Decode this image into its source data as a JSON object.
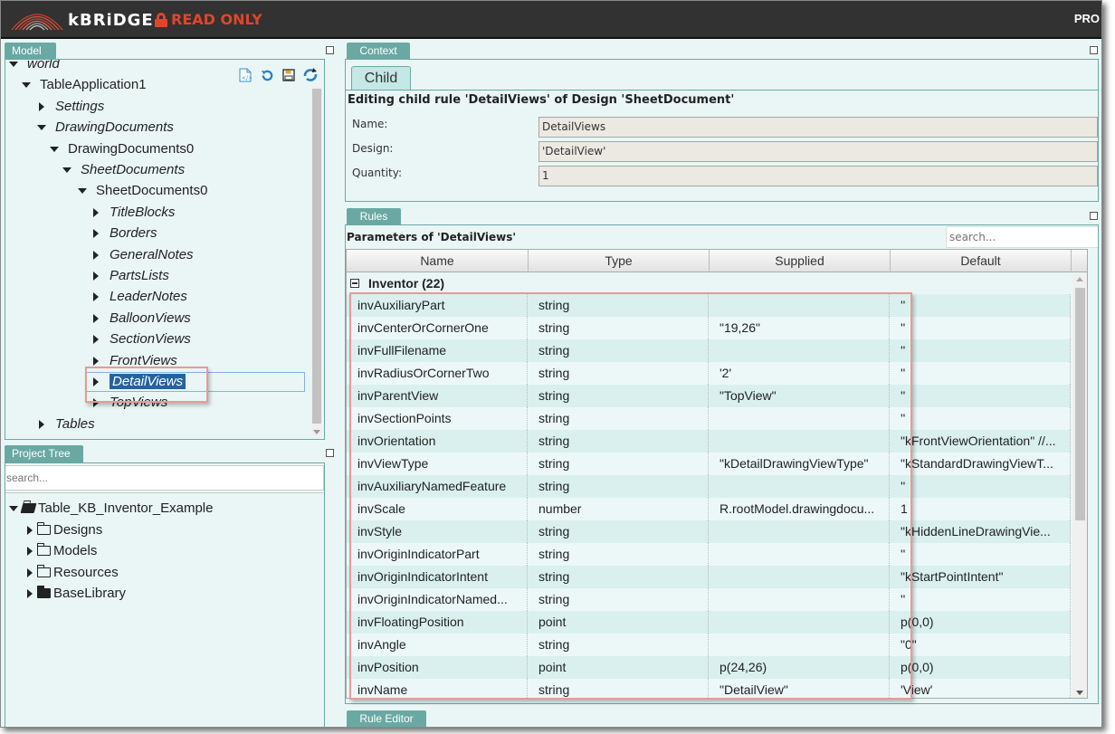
{
  "header": {
    "brand": "kBRiDGE",
    "mode": "READ ONLY",
    "right_label": "PRO"
  },
  "model_panel": {
    "tab": "Model",
    "tree": [
      {
        "label": "world",
        "depth": 0,
        "expanded": true,
        "italic": true
      },
      {
        "label": "TableApplication1",
        "depth": 1,
        "expanded": true,
        "italic": false
      },
      {
        "label": "Settings",
        "depth": 2,
        "expanded": false,
        "italic": true
      },
      {
        "label": "DrawingDocuments",
        "depth": 2,
        "expanded": true,
        "italic": true
      },
      {
        "label": "DrawingDocuments0",
        "depth": 3,
        "expanded": true,
        "italic": false
      },
      {
        "label": "SheetDocuments",
        "depth": 4,
        "expanded": true,
        "italic": true
      },
      {
        "label": "SheetDocuments0",
        "depth": 5,
        "expanded": true,
        "italic": false
      },
      {
        "label": "TitleBlocks",
        "depth": 6,
        "expanded": false,
        "italic": true
      },
      {
        "label": "Borders",
        "depth": 6,
        "expanded": false,
        "italic": true
      },
      {
        "label": "GeneralNotes",
        "depth": 6,
        "expanded": false,
        "italic": true
      },
      {
        "label": "PartsLists",
        "depth": 6,
        "expanded": false,
        "italic": true
      },
      {
        "label": "LeaderNotes",
        "depth": 6,
        "expanded": false,
        "italic": true
      },
      {
        "label": "BalloonViews",
        "depth": 6,
        "expanded": false,
        "italic": true
      },
      {
        "label": "SectionViews",
        "depth": 6,
        "expanded": false,
        "italic": true
      },
      {
        "label": "FrontViews",
        "depth": 6,
        "expanded": false,
        "italic": true
      },
      {
        "label": "DetailViews",
        "depth": 6,
        "expanded": false,
        "italic": true,
        "selected": true
      },
      {
        "label": "TopViews",
        "depth": 6,
        "expanded": false,
        "italic": true
      },
      {
        "label": "Tables",
        "depth": 2,
        "expanded": false,
        "italic": true
      }
    ],
    "toolbar_icons": [
      "xml-file-icon",
      "undo-icon",
      "save-icon",
      "refresh-icon"
    ]
  },
  "project_panel": {
    "tab": "Project Tree",
    "search_placeholder": "search...",
    "root": "Table_KB_Inventor_Example",
    "children": [
      {
        "label": "Designs",
        "icon": "folder-outline"
      },
      {
        "label": "Models",
        "icon": "folder-outline"
      },
      {
        "label": "Resources",
        "icon": "folder-outline"
      },
      {
        "label": "BaseLibrary",
        "icon": "folder-filled"
      }
    ]
  },
  "context_panel": {
    "tab": "Context",
    "subtab": "Child",
    "title": "Editing child rule 'DetailViews' of Design 'SheetDocument'",
    "fields": [
      {
        "label": "Name:",
        "value": "DetailViews"
      },
      {
        "label": "Design:",
        "value": "'DetailView'"
      },
      {
        "label": "Quantity:",
        "value": "1"
      }
    ]
  },
  "rules_panel": {
    "tab": "Rules",
    "title": "Parameters of 'DetailViews'",
    "search_placeholder": "search...",
    "columns": [
      "Name",
      "Type",
      "Supplied",
      "Default"
    ],
    "group": "Inventor (22)",
    "rows": [
      [
        "invAuxiliaryPart",
        "string",
        "",
        "''"
      ],
      [
        "invCenterOrCornerOne",
        "string",
        "\"19,26\"",
        "''"
      ],
      [
        "invFullFilename",
        "string",
        "",
        "''"
      ],
      [
        "invRadiusOrCornerTwo",
        "string",
        "'2'",
        "''"
      ],
      [
        "invParentView",
        "string",
        "\"TopView\"",
        "''"
      ],
      [
        "invSectionPoints",
        "string",
        "",
        "''"
      ],
      [
        "invOrientation",
        "string",
        "",
        "\"kFrontViewOrientation\" //..."
      ],
      [
        "invViewType",
        "string",
        "\"kDetailDrawingViewType\"",
        "\"kStandardDrawingViewT..."
      ],
      [
        "invAuxiliaryNamedFeature",
        "string",
        "",
        "''"
      ],
      [
        "invScale",
        "number",
        "R.rootModel.drawingdocu...",
        "1"
      ],
      [
        "invStyle",
        "string",
        "",
        "\"kHiddenLineDrawingVie..."
      ],
      [
        "invOriginIndicatorPart",
        "string",
        "",
        "''"
      ],
      [
        "invOriginIndicatorIntent",
        "string",
        "",
        "\"kStartPointIntent\""
      ],
      [
        "invOriginIndicatorNamed...",
        "string",
        "",
        "''"
      ],
      [
        "invFloatingPosition",
        "point",
        "",
        "p(0,0)"
      ],
      [
        "invAngle",
        "string",
        "",
        "\"0\""
      ],
      [
        "invPosition",
        "point",
        "p(24,26)",
        "p(0,0)"
      ],
      [
        "invName",
        "string",
        "\"DetailView\"",
        "'View'"
      ]
    ]
  },
  "rule_editor_panel": {
    "tab": "Rule Editor"
  },
  "colors": {
    "panel_tab": "#6aa9a3",
    "panel_bg": "#eaf6f6",
    "selection": "#2563a0",
    "read_only": "#e0452a",
    "highlight_box": "#e79a9a"
  }
}
